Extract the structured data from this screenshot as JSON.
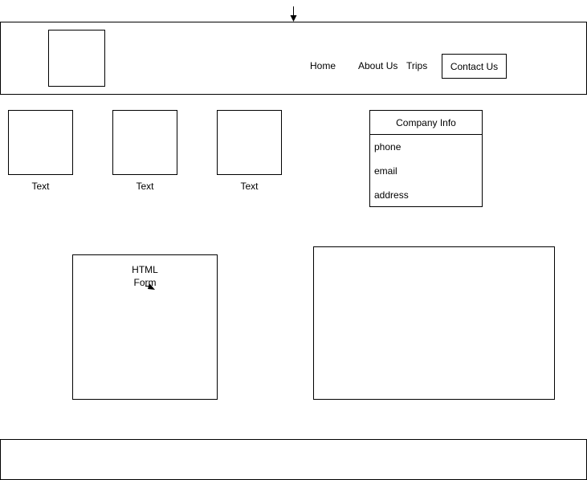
{
  "nav": {
    "home": "Home",
    "about": "About Us",
    "trips": "Trips",
    "contact": "Contact Us"
  },
  "thumbnails": [
    {
      "label": "Text"
    },
    {
      "label": "Text"
    },
    {
      "label": "Text"
    }
  ],
  "company_info": {
    "title": "Company Info",
    "rows": [
      "phone",
      "email",
      "address"
    ]
  },
  "form": {
    "line1": "HTML",
    "line2": "Form"
  }
}
